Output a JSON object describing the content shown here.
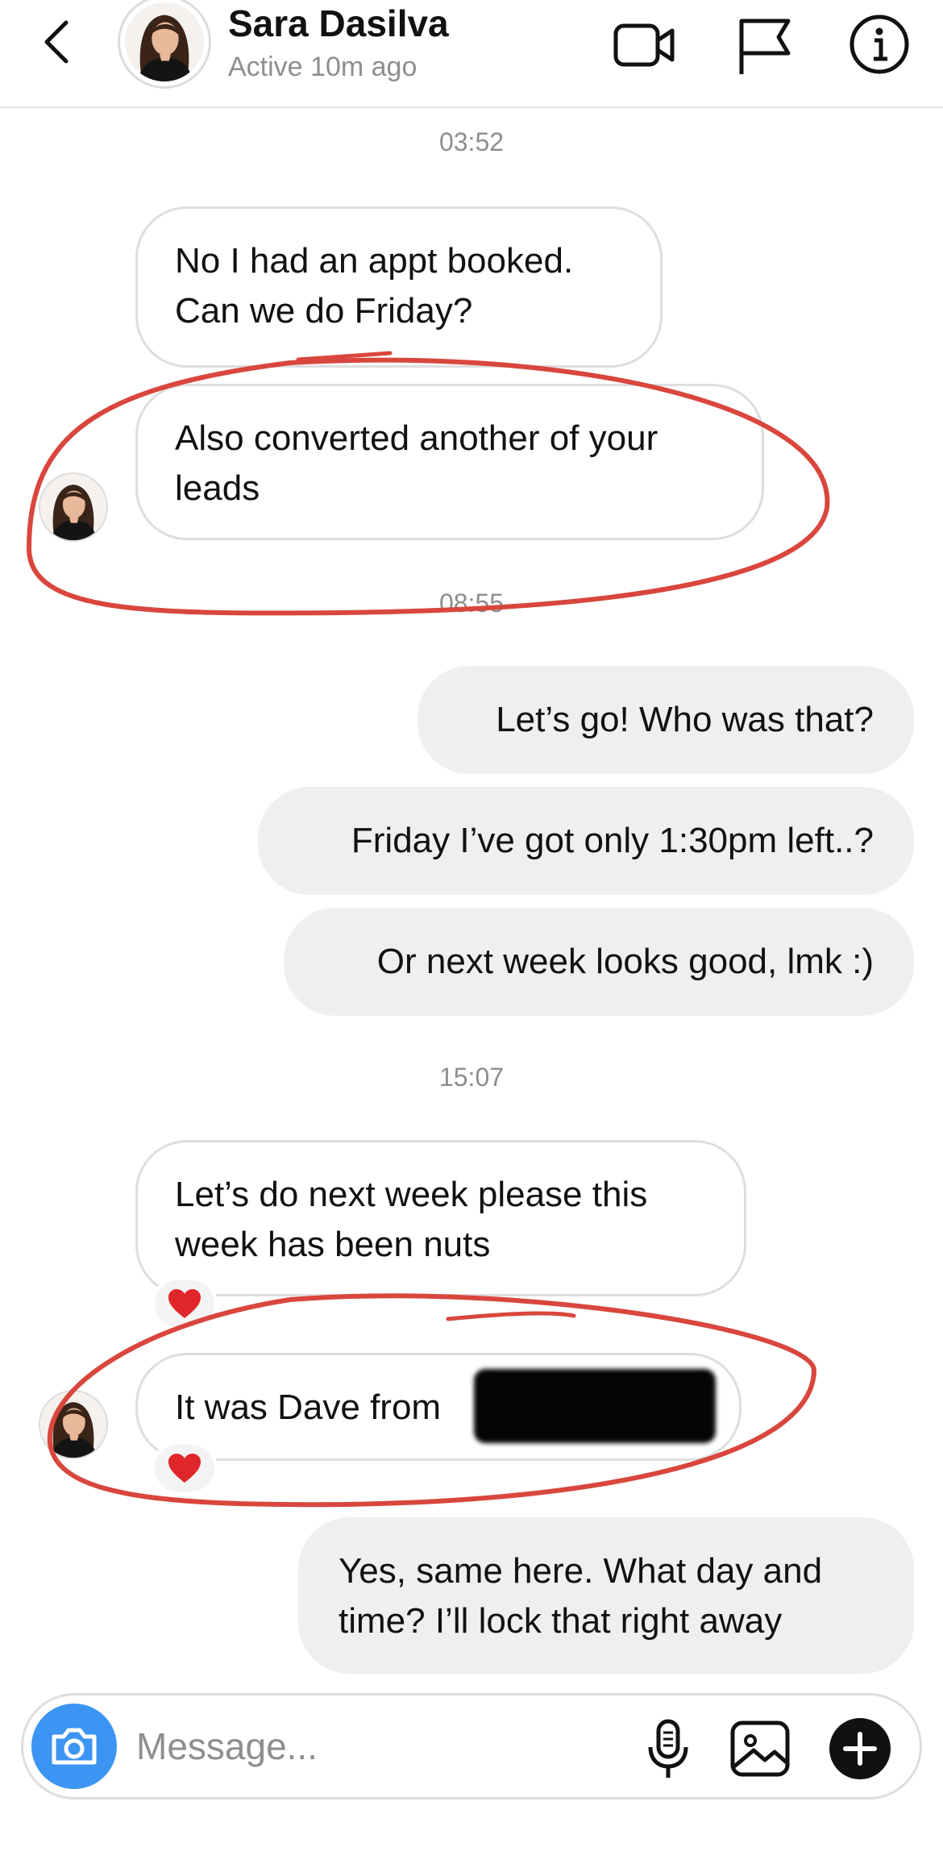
{
  "header": {
    "name": "Sara Dasilva",
    "status": "Active 10m ago",
    "icons": [
      "back-chevron-icon",
      "video-call-icon",
      "flag-icon",
      "info-icon"
    ]
  },
  "thread": {
    "timestamps": [
      "03:52",
      "08:55",
      "15:07"
    ],
    "messages": [
      {
        "direction": "in",
        "lines": [
          "No I had an appt booked.",
          "Can we do Friday?"
        ]
      },
      {
        "direction": "in",
        "lines": [
          "Also converted another of your",
          "leads"
        ]
      },
      {
        "direction": "out",
        "lines": [
          "Let’s go! Who was that?"
        ]
      },
      {
        "direction": "out",
        "lines": [
          "Friday I’ve got only 1:30pm left..?"
        ]
      },
      {
        "direction": "out",
        "lines": [
          "Or next week looks good, lmk :)"
        ]
      },
      {
        "direction": "in",
        "lines": [
          "Let’s do next week please this",
          "week has been nuts"
        ],
        "reaction": "heart"
      },
      {
        "direction": "in",
        "lines": [
          "It was Dave from"
        ],
        "reaction": "heart",
        "redacted": true
      },
      {
        "direction": "out",
        "lines": [
          "Yes, same here. What day and",
          "time? I’ll lock that right away"
        ]
      }
    ]
  },
  "composer": {
    "placeholder": "Message...",
    "icons": [
      "camera-icon",
      "microphone-icon",
      "gallery-icon",
      "plus-icon"
    ]
  },
  "colors": {
    "accent_blue": "#3c95f2",
    "outgoing_bubble": "#efefef",
    "incoming_border": "#dedede",
    "muted_text": "#8e8e8e",
    "heart": "#e0262b",
    "annotation_red": "#d9463d"
  }
}
